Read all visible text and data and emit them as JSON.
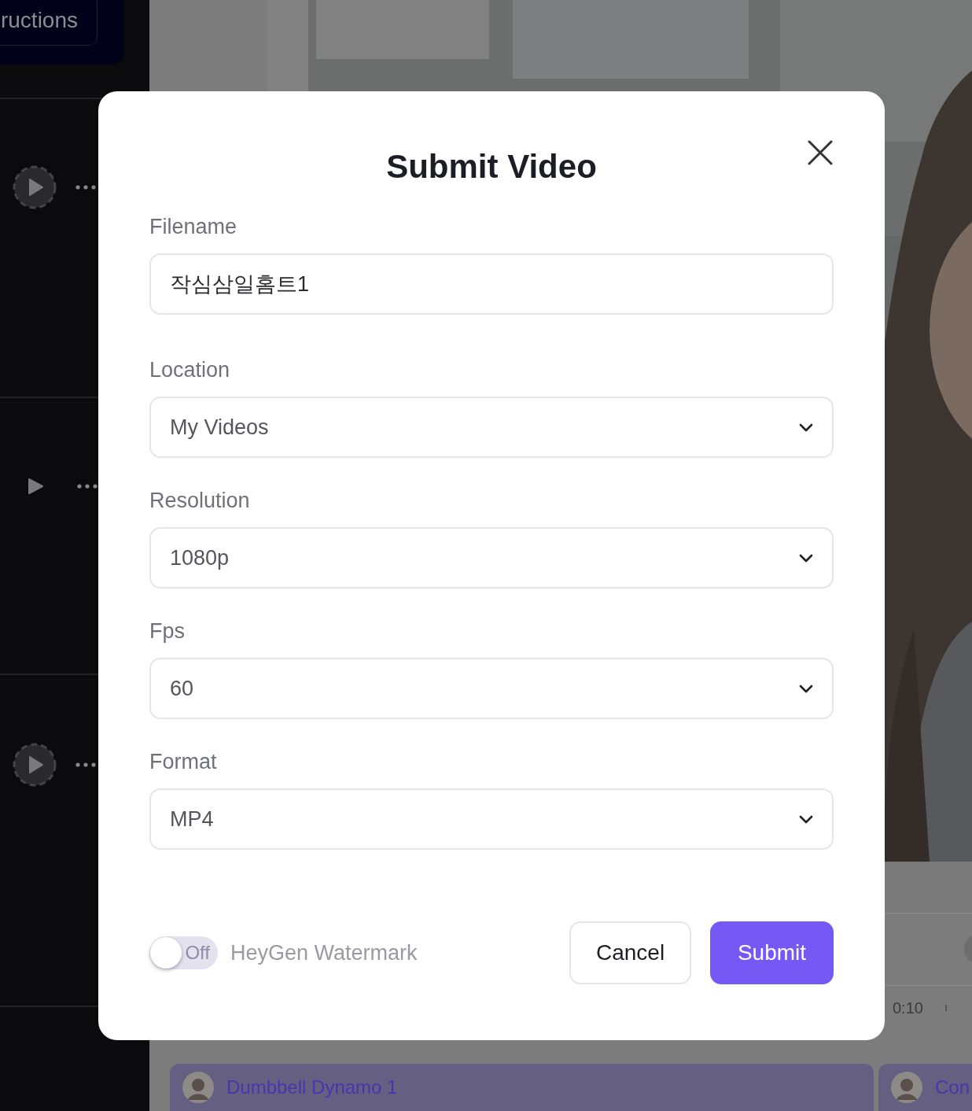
{
  "sidebar": {
    "instructions_button": "ructions",
    "rows": [
      {
        "kind": "circle-play"
      },
      {
        "kind": "plain-play"
      },
      {
        "kind": "circle-play"
      }
    ]
  },
  "timeline": {
    "time": "0:10"
  },
  "clips": [
    {
      "title": "Dumbbell Dynamo 1"
    },
    {
      "title": "Con"
    }
  ],
  "modal": {
    "title": "Submit Video",
    "fields": [
      {
        "kind": "text",
        "label": "Filename",
        "value": "작심삼일홈트1"
      },
      {
        "kind": "select",
        "label": "Location",
        "value": "My Videos"
      },
      {
        "kind": "select",
        "label": "Resolution",
        "value": "1080p"
      },
      {
        "kind": "select",
        "label": "Fps",
        "value": "60"
      },
      {
        "kind": "select",
        "label": "Format",
        "value": "MP4"
      }
    ],
    "watermark": {
      "on": false,
      "state_label": "Off",
      "label": "HeyGen Watermark"
    },
    "buttons": [
      {
        "kind": "secondary",
        "label": "Cancel"
      },
      {
        "kind": "primary",
        "label": "Submit"
      }
    ]
  }
}
